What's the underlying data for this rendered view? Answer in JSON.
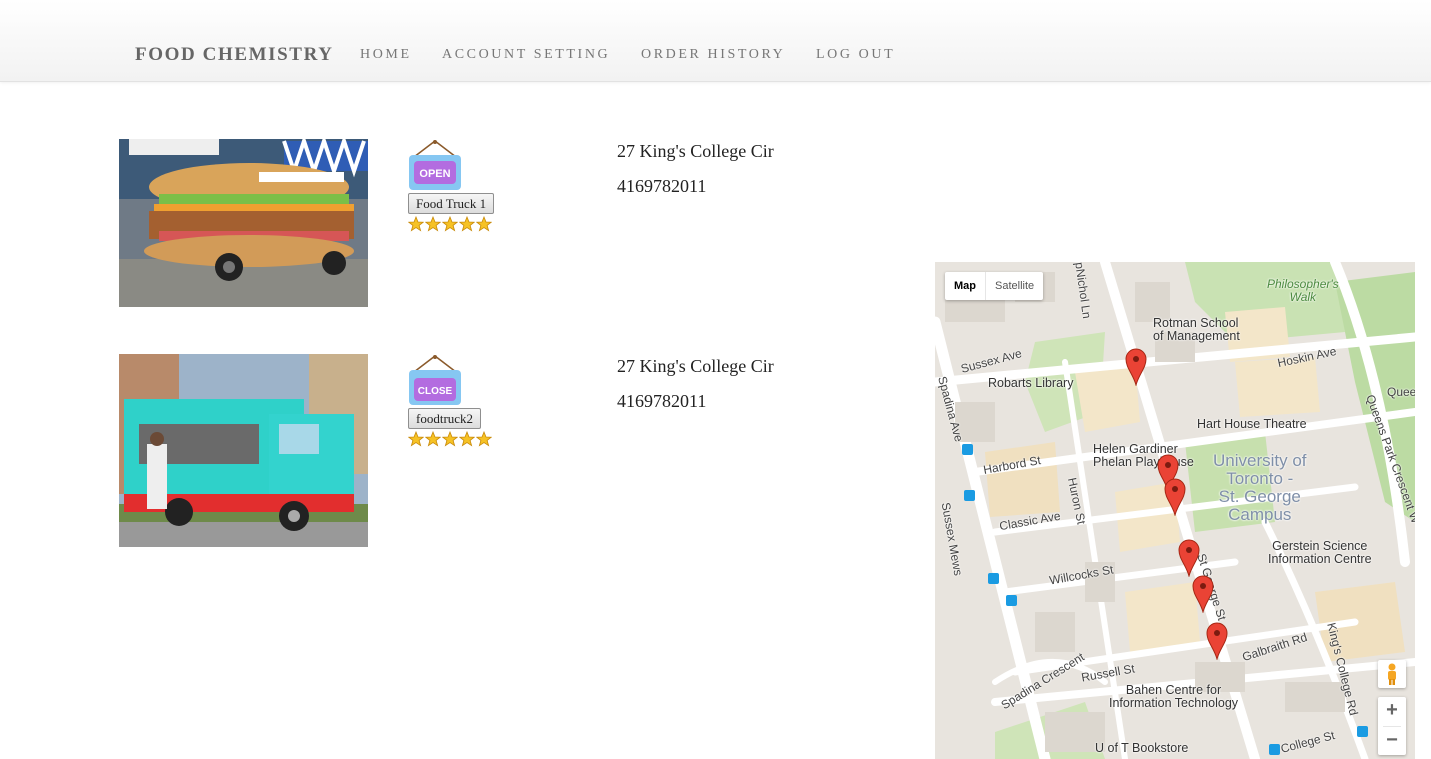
{
  "navbar": {
    "brand": "FOOD CHEMISTRY",
    "links": [
      "HOME",
      "ACCOUNT SETTING",
      "ORDER HISTORY",
      "LOG OUT"
    ]
  },
  "trucks": [
    {
      "status": "OPEN",
      "name": "Food Truck 1",
      "rating": 5,
      "address": "27 King's College Cir",
      "phone": "4169782011",
      "status_color": "#b36ce0"
    },
    {
      "status": "CLOSE",
      "name": "foodtruck2",
      "rating": 5,
      "address": "27 King's College Cir",
      "phone": "4169782011",
      "status_color": "#b36ce0"
    }
  ],
  "map": {
    "type_options": [
      "Map",
      "Satellite"
    ],
    "selected_type": "Map",
    "labels": {
      "rotman": "Rotman School\nof Management",
      "robarts": "Robarts Library",
      "hart_house": "Hart House Theatre",
      "helen": "Helen Gardiner\nPhelan Playhouse",
      "campus": "University of\nToronto -\nSt. George\nCampus",
      "gerstein": "Gerstein Science\nInformation Centre",
      "bahen": "Bahen Centre for\nInformation Technology",
      "bookstore": "U of T Bookstore",
      "philosophers": "Philosopher's\nWalk",
      "sussex": "Sussex Ave",
      "hoskin": "Hoskin Ave",
      "harbord": "Harbord St",
      "classic": "Classic Ave",
      "willcocks": "Willcocks St",
      "russell": "Russell St",
      "galbraith": "Galbraith Rd",
      "college": "College St",
      "spadina_ave": "Spadina Ave",
      "spadina_cres": "Spadina Crescent",
      "huron": "Huron St",
      "queens_park": "Queens Park Crescent W",
      "kings_college": "King's College Rd",
      "st_george": "St George St",
      "mcnichol": "bpNichol Ln",
      "queens": "Quee",
      "sussex_mews": "Sussex Mews"
    },
    "zoom_in": "+",
    "zoom_out": "−",
    "marker_color": "#ea4335",
    "marker_count": 6
  },
  "colors": {
    "open_sign": "#b36ce0",
    "star": "#f6c225"
  }
}
